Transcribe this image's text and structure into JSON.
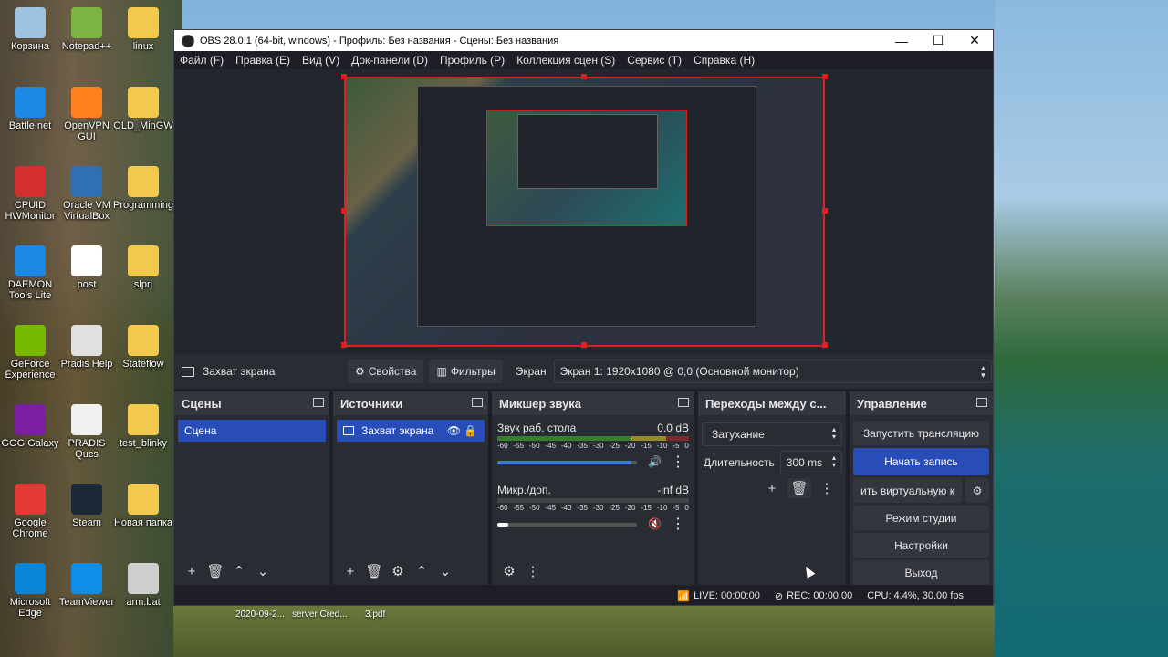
{
  "desktop": {
    "icons": [
      {
        "label": "Корзина",
        "color": "#9ec3e0"
      },
      {
        "label": "Notepad++",
        "color": "#7cb342"
      },
      {
        "label": "linux",
        "color": "#f2c94c"
      },
      {
        "label": "Battle.net",
        "color": "#1e88e5"
      },
      {
        "label": "OpenVPN GUI",
        "color": "#ff7f1f"
      },
      {
        "label": "OLD_MinGW",
        "color": "#f2c94c"
      },
      {
        "label": "CPUID HWMonitor",
        "color": "#d32f2f"
      },
      {
        "label": "Oracle VM VirtualBox",
        "color": "#2e6fb5"
      },
      {
        "label": "Programming",
        "color": "#f2c94c"
      },
      {
        "label": "DAEMON Tools Lite",
        "color": "#1e88e5"
      },
      {
        "label": "post",
        "color": "#ffffff"
      },
      {
        "label": "slprj",
        "color": "#f2c94c"
      },
      {
        "label": "GeForce Experience",
        "color": "#76b900"
      },
      {
        "label": "Pradis Help",
        "color": "#e0e0e0"
      },
      {
        "label": "Stateflow",
        "color": "#f2c94c"
      },
      {
        "label": "GOG Galaxy",
        "color": "#7b1fa2"
      },
      {
        "label": "PRADIS Qucs",
        "color": "#f0f0f0"
      },
      {
        "label": "test_blinky",
        "color": "#f2c94c"
      },
      {
        "label": "Google Chrome",
        "color": "#e53935"
      },
      {
        "label": "Steam",
        "color": "#1b2838"
      },
      {
        "label": "Новая папка",
        "color": "#f2c94c"
      },
      {
        "label": "Microsoft Edge",
        "color": "#0a84d6"
      },
      {
        "label": "TeamViewer",
        "color": "#0e8ee9"
      },
      {
        "label": "arm.bat",
        "color": "#cfcfcf"
      }
    ],
    "taskfiles": [
      "2020-09-2...",
      "server Cred...",
      "3.pdf"
    ]
  },
  "window": {
    "title": "OBS 28.0.1 (64-bit, windows) - Профиль: Без названия - Сцены: Без названия",
    "controls": {
      "minimize": "—",
      "maximize": "☐",
      "close": "✕"
    },
    "menu": [
      "Файл (F)",
      "Правка (E)",
      "Вид (V)",
      "Док-панели (D)",
      "Профиль (P)",
      "Коллекция сцен (S)",
      "Сервис (T)",
      "Справка (H)"
    ]
  },
  "source_bar": {
    "source_name": "Захват экрана",
    "properties": "Свойства",
    "filters": "Фильтры",
    "screen_label": "Экран",
    "screen_value": "Экран 1: 1920x1080 @ 0,0 (Основной монитор)"
  },
  "scenes": {
    "title": "Сцены",
    "items": [
      "Сцена"
    ]
  },
  "sources": {
    "title": "Источники",
    "items": [
      "Захват экрана"
    ]
  },
  "mixer": {
    "title": "Микшер звука",
    "channels": [
      {
        "name": "Звук раб. стола",
        "level": "0.0 dB",
        "volume": 0.96,
        "muted": false
      },
      {
        "name": "Микр./доп.",
        "level": "-inf dB",
        "volume": 0.08,
        "muted": true
      }
    ],
    "scale": [
      "-60",
      "-55",
      "-50",
      "-45",
      "-40",
      "-35",
      "-30",
      "-25",
      "-20",
      "-15",
      "-10",
      "-5",
      "0"
    ]
  },
  "transitions": {
    "title": "Переходы между с...",
    "type": "Затухание",
    "duration_label": "Длительность",
    "duration_value": "300 ms"
  },
  "controls": {
    "title": "Управление",
    "start_stream": "Запустить трансляцию",
    "start_record": "Начать запись",
    "virtual_cam": "ить виртуальную к",
    "studio_mode": "Режим студии",
    "settings": "Настройки",
    "exit": "Выход"
  },
  "status": {
    "live": "LIVE: 00:00:00",
    "rec": "REC: 00:00:00",
    "cpu": "CPU: 4.4%, 30.00 fps"
  },
  "colors": {
    "accent": "#284cb8",
    "selection_border": "#e02020",
    "panel": "#2a2c34",
    "background": "#1e1f26"
  }
}
